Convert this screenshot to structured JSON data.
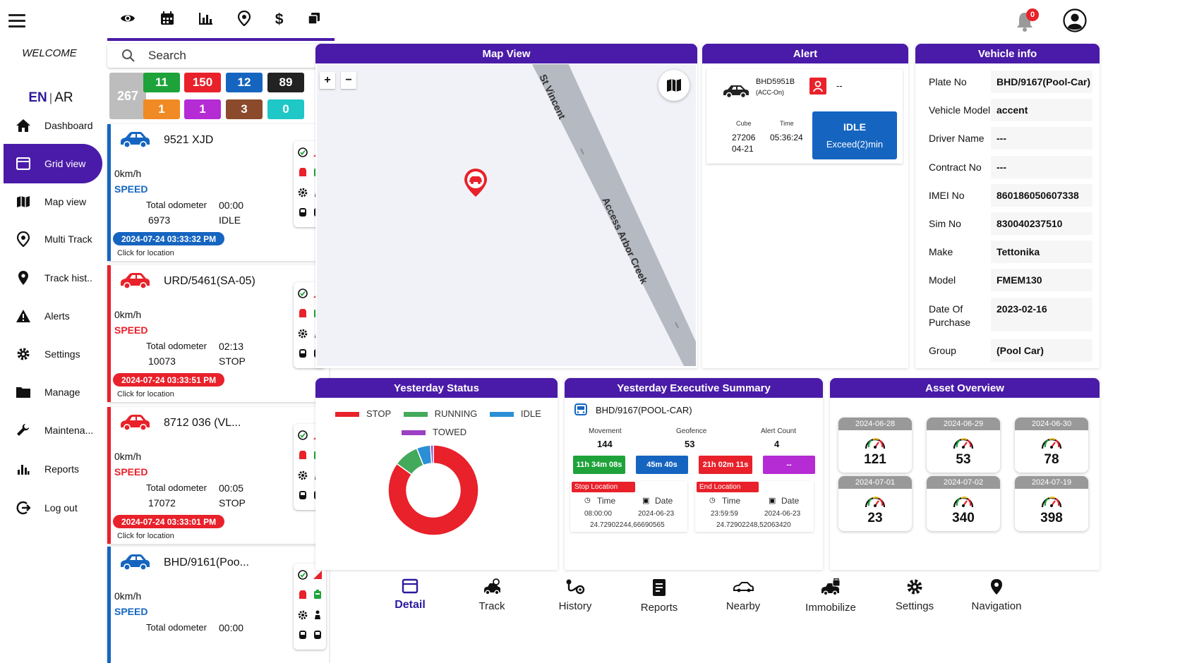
{
  "sidebar": {
    "welcome": "WELCOME",
    "lang_en": "EN",
    "lang_sep": "|",
    "lang_ar": "AR",
    "items": [
      {
        "label": "Dashboard",
        "icon": "home-icon"
      },
      {
        "label": "Grid view",
        "icon": "grid-icon"
      },
      {
        "label": "Map view",
        "icon": "map-icon"
      },
      {
        "label": "Multi Track",
        "icon": "location-icon"
      },
      {
        "label": "Track hist..",
        "icon": "pin-icon"
      },
      {
        "label": "Alerts",
        "icon": "warning-icon"
      },
      {
        "label": "Settings",
        "icon": "gear-icon"
      },
      {
        "label": "Manage",
        "icon": "folder-icon"
      },
      {
        "label": "Maintena...",
        "icon": "wrench-icon"
      },
      {
        "label": "Reports",
        "icon": "bar-chart-icon"
      },
      {
        "label": "Log out",
        "icon": "logout-icon"
      }
    ]
  },
  "header": {
    "notification_count": "0"
  },
  "search": {
    "placeholder": "Search"
  },
  "counts": {
    "total": "267",
    "items": [
      {
        "value": "11",
        "color": "#1ea33a"
      },
      {
        "value": "150",
        "color": "#e8212a"
      },
      {
        "value": "12",
        "color": "#1565c0"
      },
      {
        "value": "89",
        "color": "#222222"
      },
      {
        "value": "1",
        "color": "#f08a24"
      },
      {
        "value": "1",
        "color": "#b52bd4"
      },
      {
        "value": "3",
        "color": "#8b4a2b"
      },
      {
        "value": "0",
        "color": "#1fc7c7"
      }
    ]
  },
  "vehicles": [
    {
      "plate": "9521 XJD",
      "speed": "0km/h",
      "speed_label": "SPEED",
      "odo_label": "Total odometer",
      "odometer": "6973",
      "duration": "00:00",
      "state": "IDLE",
      "timestamp": "2024-07-24 03:33:32 PM",
      "location": "Click for location",
      "color": "#1565c0"
    },
    {
      "plate": "URD/5461(SA-05)",
      "speed": "0km/h",
      "speed_label": "SPEED",
      "odo_label": "Total odometer",
      "odometer": "10073",
      "duration": "02:13",
      "state": "STOP",
      "timestamp": "2024-07-24 03:33:51 PM",
      "location": "Click for location",
      "color": "#e8212a"
    },
    {
      "plate": "8712 036 (VL...",
      "speed": "0km/h",
      "speed_label": "SPEED",
      "odo_label": "Total odometer",
      "odometer": "17072",
      "duration": "00:05",
      "state": "STOP",
      "timestamp": "2024-07-24 03:33:01 PM",
      "location": "Click for location",
      "color": "#e8212a"
    },
    {
      "plate": "BHD/9161(Poo...",
      "speed": "0km/h",
      "speed_label": "SPEED",
      "odo_label": "Total odometer",
      "odometer": "",
      "duration": "00:00",
      "state": "",
      "timestamp": "",
      "location": "",
      "color": "#1565c0"
    }
  ],
  "map": {
    "title": "Map View",
    "zoom_in": "+",
    "zoom_out": "−",
    "road1": "St Vincent",
    "road2": "Access Arbor Creek"
  },
  "alert": {
    "title": "Alert",
    "plate": "BHD5951B",
    "acc": "(ACC-On)",
    "driver": "--",
    "cube_label": "Cube",
    "cube_value": "27206",
    "cube_date": "04-21",
    "time_label": "Time",
    "time_value": "05:36:24",
    "status": "IDLE",
    "status_sub": "Exceed(2)min"
  },
  "vehicle_info": {
    "title": "Vehicle info",
    "rows": [
      {
        "label": "Plate No",
        "value": "BHD/9167(Pool-Car)"
      },
      {
        "label": "Vehicle Model",
        "value": "accent"
      },
      {
        "label": "Driver Name",
        "value": "---"
      },
      {
        "label": "Contract No",
        "value": "---"
      },
      {
        "label": "IMEI No",
        "value": "860186050607338"
      },
      {
        "label": "Sim No",
        "value": "830040237510"
      },
      {
        "label": "Make",
        "value": "Tettonika"
      },
      {
        "label": "Model",
        "value": "FMEM130"
      },
      {
        "label": "Date Of Purchase",
        "value": "2023-02-16"
      },
      {
        "label": "Group",
        "value": "(Pool Car)"
      }
    ]
  },
  "yesterday_status": {
    "title": "Yesterday Status",
    "legend": [
      {
        "name": "STOP",
        "color": "#e8212a"
      },
      {
        "name": "RUNNING",
        "color": "#43a95b"
      },
      {
        "name": "IDLE",
        "color": "#2b8fd6"
      },
      {
        "name": "TOWED",
        "color": "#9b40c3"
      }
    ]
  },
  "chart_data": {
    "type": "pie",
    "categories": [
      "STOP",
      "RUNNING",
      "IDLE",
      "TOWED"
    ],
    "values": [
      85,
      9,
      5,
      1
    ],
    "colors": [
      "#e8212a",
      "#43a95b",
      "#2b8fd6",
      "#9b40c3"
    ],
    "donut": true,
    "title": "Yesterday Status",
    "legend_position": "top"
  },
  "exec_summary": {
    "title": "Yesterday Executive Summary",
    "vehicle": "BHD/9167(POOL-CAR)",
    "movement_label": "Movement",
    "movement_value": "144",
    "geofence_label": "Geofence",
    "geofence_value": "53",
    "alertcount_label": "Alert Count",
    "alertcount_value": "4",
    "durations": [
      {
        "value": "11h 34m 08s",
        "color": "#1ea33a"
      },
      {
        "value": "45m 40s",
        "color": "#1565c0"
      },
      {
        "value": "21h 02m 11s",
        "color": "#e8212a"
      },
      {
        "value": "--",
        "color": "#b52bd4"
      }
    ],
    "stop_location": {
      "label": "Stop Location",
      "time_label": "Time",
      "date_label": "Date",
      "time": "08:00:00",
      "date": "2024-06-23",
      "coords": "24.72902244,66690565"
    },
    "end_location": {
      "label": "End Location",
      "time_label": "Time",
      "date_label": "Date",
      "time": "23:59:59",
      "date": "2024-06-23",
      "coords": "24.72902248,52063420"
    }
  },
  "asset_overview": {
    "title": "Asset Overview",
    "items": [
      {
        "date": "2024-06-28",
        "value": "121"
      },
      {
        "date": "2024-06-29",
        "value": "53"
      },
      {
        "date": "2024-06-30",
        "value": "78"
      },
      {
        "date": "2024-07-01",
        "value": "23"
      },
      {
        "date": "2024-07-02",
        "value": "340"
      },
      {
        "date": "2024-07-19",
        "value": "398"
      }
    ]
  },
  "bottom_nav": [
    {
      "label": "Detail",
      "icon": "detail-icon",
      "active": true,
      "color": "#2a1a9e"
    },
    {
      "label": "Track",
      "icon": "track-icon"
    },
    {
      "label": "History",
      "icon": "history-icon"
    },
    {
      "label": "Reports",
      "icon": "reports-icon"
    },
    {
      "label": "Nearby",
      "icon": "nearby-icon"
    },
    {
      "label": "Immobilize",
      "icon": "immobilize-icon"
    },
    {
      "label": "Settings",
      "icon": "settings-icon"
    },
    {
      "label": "Navigation",
      "icon": "navigation-icon"
    }
  ],
  "colors": {
    "accent": "#4a1ba8",
    "brand_blue": "#2a1a9e"
  }
}
